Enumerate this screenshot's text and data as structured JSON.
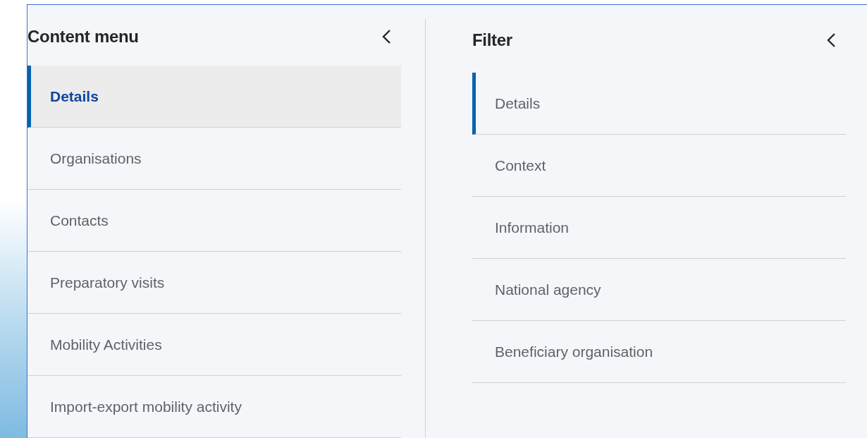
{
  "panels": [
    {
      "title": "Content menu",
      "items": [
        {
          "label": "Details",
          "selected": true,
          "marked": true
        },
        {
          "label": "Organisations",
          "selected": false,
          "marked": false
        },
        {
          "label": "Contacts",
          "selected": false,
          "marked": false
        },
        {
          "label": "Preparatory visits",
          "selected": false,
          "marked": false
        },
        {
          "label": "Mobility Activities",
          "selected": false,
          "marked": false
        },
        {
          "label": "Import-export mobility activity",
          "selected": false,
          "marked": false
        }
      ]
    },
    {
      "title": "Filter",
      "items": [
        {
          "label": "Details",
          "selected": false,
          "marked": true
        },
        {
          "label": "Context",
          "selected": false,
          "marked": false
        },
        {
          "label": "Information",
          "selected": false,
          "marked": false
        },
        {
          "label": "National agency",
          "selected": false,
          "marked": false
        },
        {
          "label": "Beneficiary organisation",
          "selected": false,
          "marked": false
        }
      ]
    }
  ]
}
